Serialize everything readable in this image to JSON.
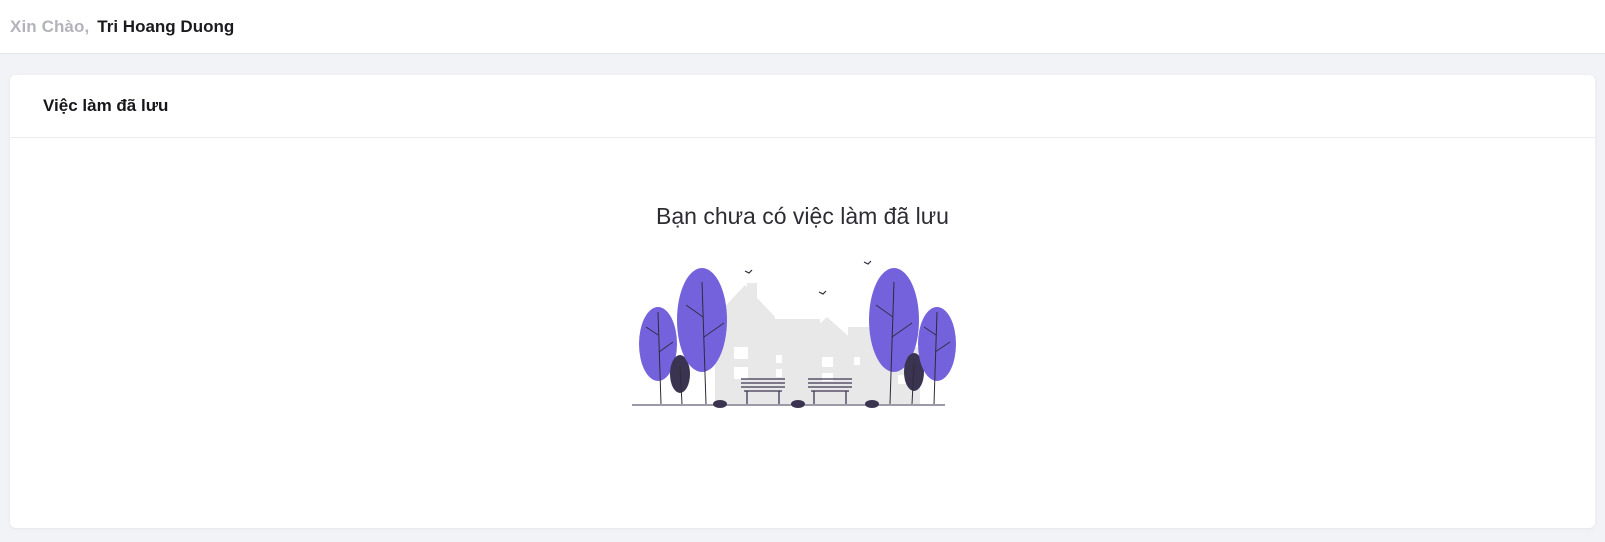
{
  "header": {
    "greeting": "Xin Chào,",
    "user_name": "Tri Hoang Duong"
  },
  "saved_jobs": {
    "title": "Việc làm đã lưu",
    "empty_message": "Bạn chưa có việc làm đã lưu",
    "illustration": "empty-city-park-illustration"
  },
  "colors": {
    "accent_purple": "#7462dc",
    "dark_purple": "#3b3451",
    "building_gray": "#e6e6e6"
  }
}
